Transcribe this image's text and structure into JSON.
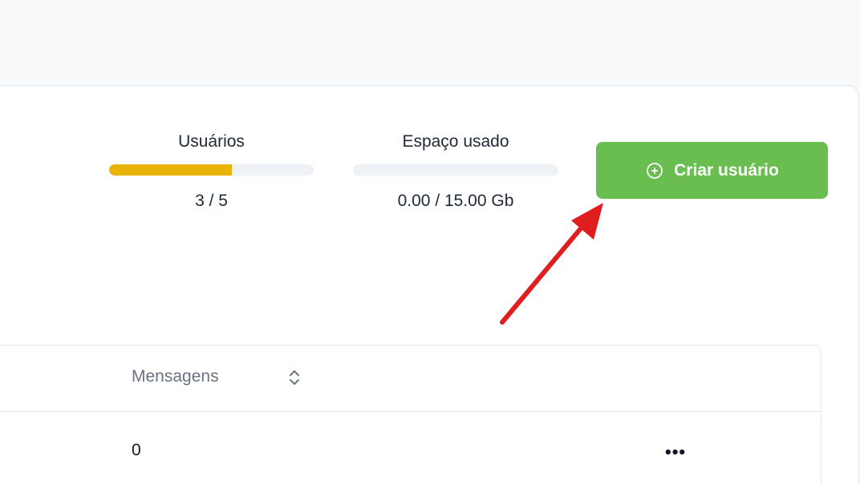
{
  "stats": {
    "users": {
      "label": "Usuários",
      "value": "3 / 5",
      "fill_fraction": 0.6,
      "fill_color": "#eab308"
    },
    "storage": {
      "label": "Espaço usado",
      "value": "0.00 / 15.00 Gb",
      "fill_fraction": 0.0
    }
  },
  "create_button": {
    "label": "Criar usuário",
    "color": "#6abe4f",
    "icon": "plus-circle-icon"
  },
  "annotation": {
    "arrow_color": "#e01e1e"
  },
  "table": {
    "columns": [
      {
        "label": "Mensagens",
        "sortable": true
      }
    ],
    "rows": [
      {
        "mensagens": "0",
        "actions_icon": "more-horizontal-icon"
      }
    ]
  }
}
